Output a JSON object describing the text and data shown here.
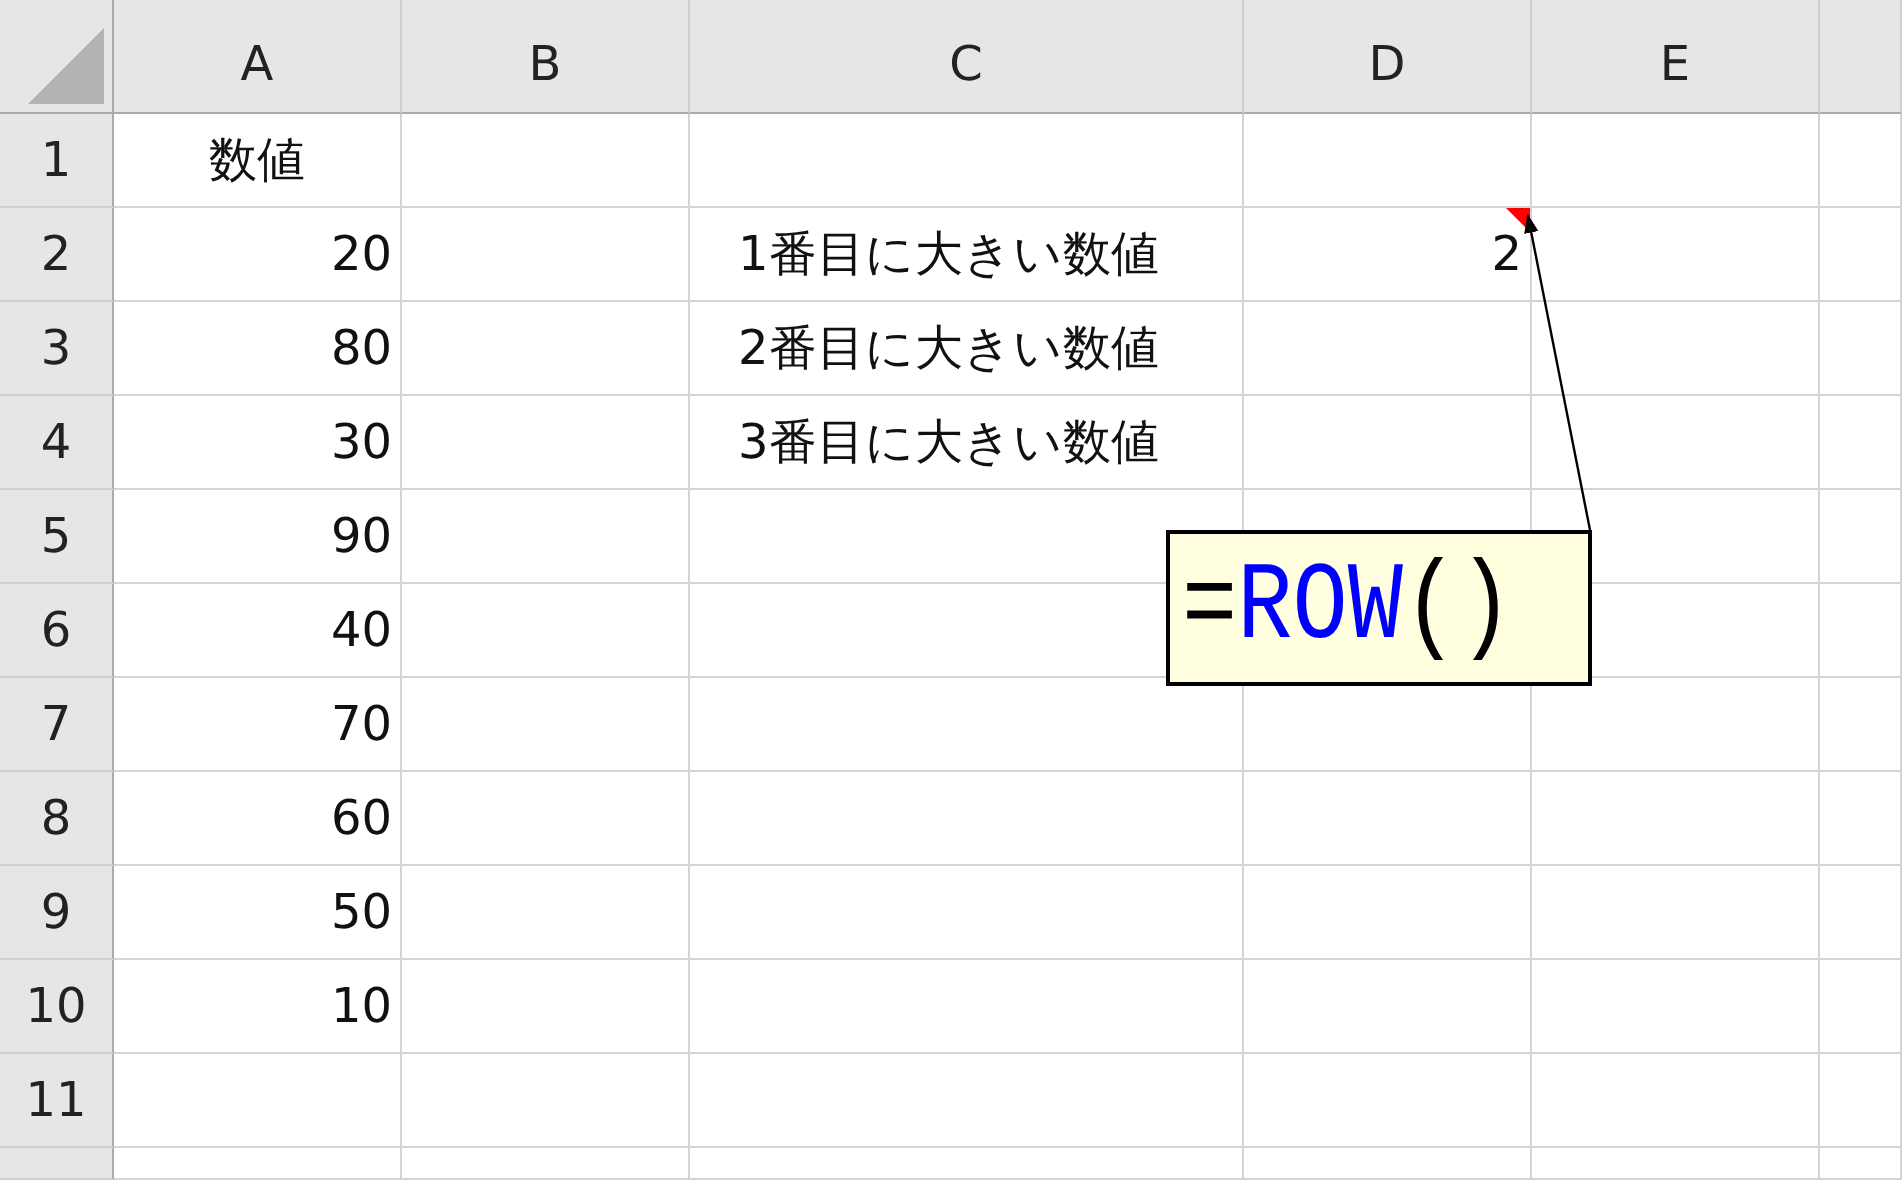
{
  "columns": [
    "A",
    "B",
    "C",
    "D",
    "E"
  ],
  "rows": [
    {
      "number": "1",
      "cells": [
        {
          "text": "数値",
          "kind": "label"
        },
        null,
        null,
        null,
        null
      ]
    },
    {
      "number": "2",
      "cells": [
        {
          "text": "20",
          "kind": "number"
        },
        null,
        {
          "text": "1番目に大きい数値",
          "kind": "text"
        },
        {
          "text": "2",
          "kind": "number",
          "has_comment": true
        },
        null
      ]
    },
    {
      "number": "3",
      "cells": [
        {
          "text": "80",
          "kind": "number"
        },
        null,
        {
          "text": "2番目に大きい数値",
          "kind": "text"
        },
        null,
        null
      ]
    },
    {
      "number": "4",
      "cells": [
        {
          "text": "30",
          "kind": "number"
        },
        null,
        {
          "text": "3番目に大きい数値",
          "kind": "text"
        },
        null,
        null
      ]
    },
    {
      "number": "5",
      "cells": [
        {
          "text": "90",
          "kind": "number"
        },
        null,
        null,
        null,
        null
      ]
    },
    {
      "number": "6",
      "cells": [
        {
          "text": "40",
          "kind": "number"
        },
        null,
        null,
        null,
        null
      ]
    },
    {
      "number": "7",
      "cells": [
        {
          "text": "70",
          "kind": "number"
        },
        null,
        null,
        null,
        null
      ]
    },
    {
      "number": "8",
      "cells": [
        {
          "text": "60",
          "kind": "number"
        },
        null,
        null,
        null,
        null
      ]
    },
    {
      "number": "9",
      "cells": [
        {
          "text": "50",
          "kind": "number"
        },
        null,
        null,
        null,
        null
      ]
    },
    {
      "number": "10",
      "cells": [
        {
          "text": "10",
          "kind": "number"
        },
        null,
        null,
        null,
        null
      ]
    },
    {
      "number": "11",
      "cells": [
        null,
        null,
        null,
        null,
        null
      ]
    }
  ],
  "comment": {
    "parts": [
      {
        "text": "=",
        "color": "#000000"
      },
      {
        "text": "ROW",
        "color": "#0000ff"
      },
      {
        "text": "()",
        "color": "#000000"
      }
    ]
  }
}
